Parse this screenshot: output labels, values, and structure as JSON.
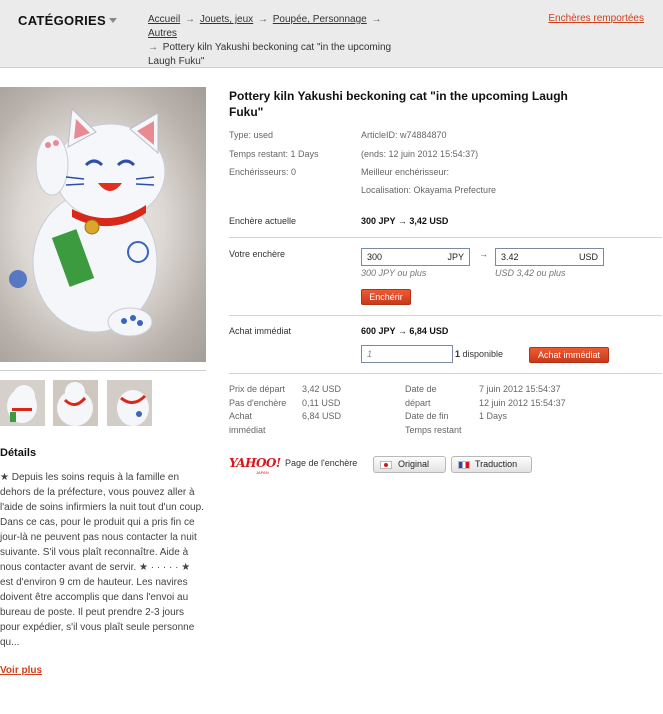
{
  "header": {
    "categories_label": "CATÉGORIES",
    "breadcrumb": [
      "Accueil",
      "Jouets, jeux",
      "Poupée, Personnage",
      "Autres"
    ],
    "breadcrumb_current": "Pottery kiln Yakushi beckoning cat \"in the upcoming Laugh Fuku\"",
    "arrow": "→",
    "reported_link": "Enchères remportées"
  },
  "icons": {
    "categories_dropdown": "caret-down-icon",
    "japan_flag": "japan-flag-icon",
    "france_flag": "france-flag-icon"
  },
  "colors": {
    "accent": "#d13f1b",
    "button": "#d9441f",
    "topbar": "#ebebeb"
  },
  "item": {
    "title": "Pottery kiln Yakushi beckoning cat \"in the upcoming Laugh Fuku\"",
    "type": "Type: used",
    "article_id": "ArticleID: w74884870",
    "time_left": "Temps restant: 1 Days",
    "ends": "(ends: 12 juin 2012 15:54:37)",
    "bidders": "Enchérisseurs: 0",
    "best_bidder": "Meilleur enchérisseur:",
    "location": "Localisation: Okayama Prefecture"
  },
  "current_bid": {
    "label": "Enchère actuelle",
    "value": "300 JPY → 3,42 USD"
  },
  "your_bid": {
    "label": "Votre enchère",
    "jpy_value": "300",
    "jpy_unit": "JPY",
    "arrow": "→",
    "usd_value": "3.42",
    "usd_unit": "USD",
    "jpy_hint": "300 JPY ou plus",
    "usd_hint": "USD 3,42 ou plus",
    "button": "Enchérir"
  },
  "buy_now": {
    "label": "Achat immédiat",
    "value": "600 JPY → 6,84 USD",
    "quantity": "1",
    "available_count": "1",
    "available_label": "disponible",
    "button": "Achat immédiat"
  },
  "summary": {
    "start_price_label": "Prix de départ",
    "start_price": "3,42 USD",
    "increment_label": "Pas d'enchère",
    "increment": "0,11 USD",
    "buyout_label_1": "Achat",
    "buyout_label_2": "immédiat",
    "buyout": "6,84 USD",
    "start_date_label_1": "Date de",
    "start_date_label_2": "départ",
    "start_date": "7 juin 2012 15:54:37",
    "end_date_label": "Date de fin",
    "end_date": "12 juin 2012 15:54:37",
    "time_left_label": "Temps restant",
    "time_left": "1 Days"
  },
  "source": {
    "logo_text": "YAHOO!",
    "logo_sub": "JAPAN",
    "page_label": "Page de l'enchère",
    "original_button": "Original",
    "translation_button": "Traduction"
  },
  "details": {
    "title": "Détails",
    "text": "★ Depuis les soins requis à la famille en dehors de la préfecture, vous pouvez aller à l'aide de soins infirmiers la nuit tout d'un coup. Dans ce cas, pour le produit qui a pris fin ce jour-là ne peuvent pas nous contacter la nuit suivante. S'il vous plaît reconnaître. Aide à nous contacter avant de servir. ★ · · · · · ★ est d'environ 9 cm de hauteur. Les navires doivent être accomplis que dans l'envoi au bureau de poste. Il peut prendre 2-3 jours pour expédier, s'il vous plaît seule personne qu...",
    "more_link": "Voir plus"
  }
}
